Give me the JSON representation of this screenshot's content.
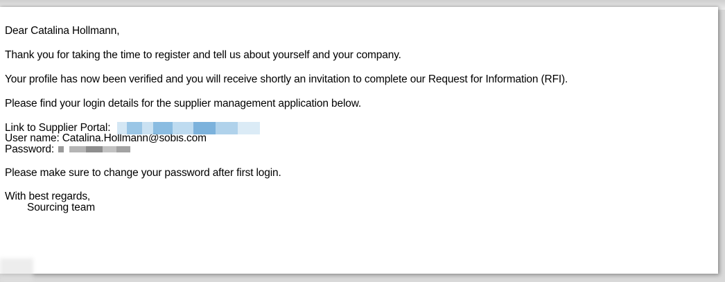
{
  "email": {
    "greeting": "Dear Catalina Hollmann,",
    "paragraph_thanks": "Thank you for taking the time to register and tell us about yourself and your company.",
    "paragraph_verified": "Your profile has now been verified and you will receive shortly an invitation to complete our Request for Information (RFI).",
    "paragraph_login_intro": "Please find your login details for the supplier management application below.",
    "credentials": {
      "link_label": "Link to Supplier Portal:",
      "username_line": "User name: Catalina.Hollmann@sobis.com",
      "password_label": "Password:"
    },
    "paragraph_change_password": "Please make sure to change your password after first login.",
    "closing": "With best regards,",
    "signature": "Sourcing team"
  }
}
